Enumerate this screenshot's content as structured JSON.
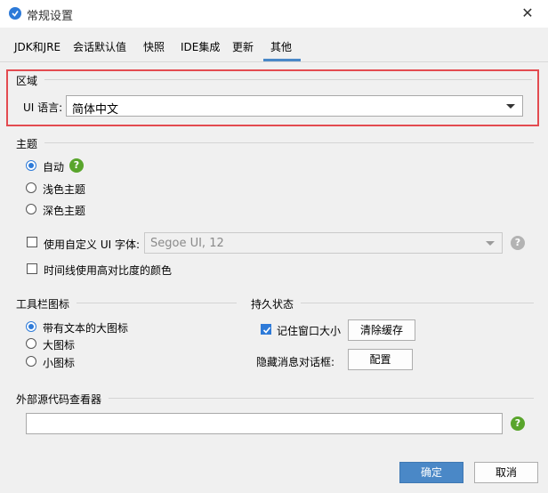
{
  "window": {
    "title": "常规设置",
    "close_glyph": "✕"
  },
  "tabs": [
    {
      "label": "JDK和JRE"
    },
    {
      "label": "会话默认值"
    },
    {
      "label": "快照"
    },
    {
      "label": "IDE集成"
    },
    {
      "label": "更新"
    },
    {
      "label": "其他",
      "selected": true
    }
  ],
  "region": {
    "title": "区域",
    "ui_language_label": "UI 语言:",
    "ui_language_value": "简体中文"
  },
  "theme": {
    "title": "主题",
    "options": [
      {
        "label": "自动",
        "checked": true
      },
      {
        "label": "浅色主题",
        "checked": false
      },
      {
        "label": "深色主题",
        "checked": false
      }
    ],
    "custom_font_label": "使用自定义 UI 字体:",
    "custom_font_value": "Segoe UI, 12",
    "high_contrast_label": "时间线使用高对比度的颜色"
  },
  "toolbar_icons": {
    "title": "工具栏图标",
    "options": [
      {
        "label": "带有文本的大图标",
        "checked": true
      },
      {
        "label": "大图标",
        "checked": false
      },
      {
        "label": "小图标",
        "checked": false
      }
    ]
  },
  "persistence": {
    "title": "持久状态",
    "remember_size_label": "记住窗口大小",
    "clear_cache_button": "清除缓存",
    "hidden_dialogs_label": "隐藏消息对话框:",
    "configure_button": "配置"
  },
  "external_viewer": {
    "title": "外部源代码查看器",
    "value": ""
  },
  "help_glyph": "?",
  "buttons": {
    "ok": "确定",
    "cancel": "取消"
  },
  "colors": {
    "accent": "#2d7ad8",
    "primary_button": "#4a88c7",
    "highlight_border": "#e34b50",
    "help_green": "#59a52c"
  }
}
